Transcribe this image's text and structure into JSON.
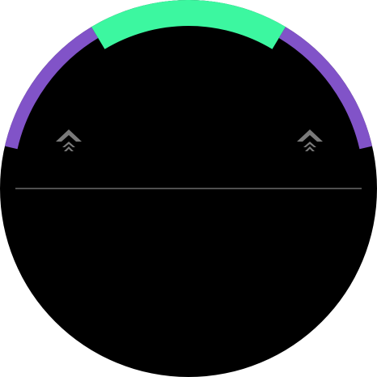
{
  "screen": {
    "shape": "round",
    "background_color": "#000000"
  },
  "gauge": {
    "center_segment_color": "#3cf7a0",
    "side_segment_color": "#8153c8",
    "left_level": 0.5,
    "center_level": 1.0,
    "right_level": 0.5
  },
  "indicators": {
    "left_icon": "chevron-up-stack-icon",
    "right_icon": "chevron-up-stack-icon",
    "color": "#7a7a7a"
  },
  "divider": {
    "color": "#6a6a6a"
  }
}
